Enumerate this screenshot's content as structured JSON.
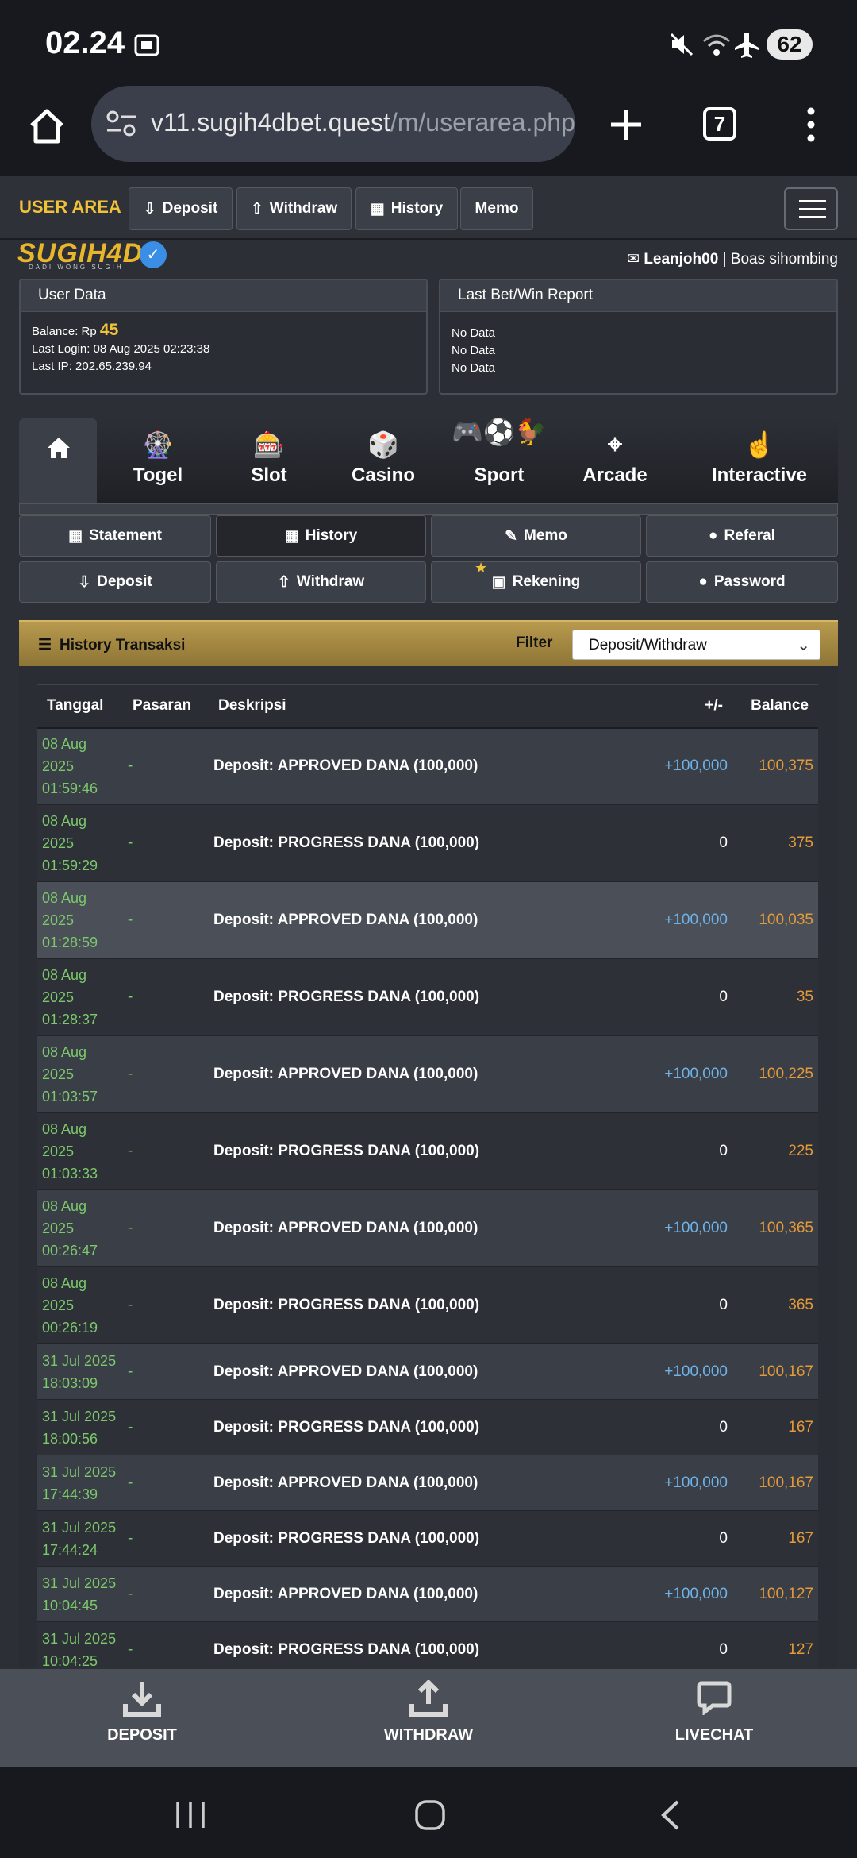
{
  "status_bar": {
    "time": "02.24",
    "battery": "62"
  },
  "browser": {
    "url_main": "v11.sugih4dbet.quest",
    "url_path": "/m/userarea.php",
    "tab_count": "7"
  },
  "user_nav": {
    "title": "USER AREA",
    "buttons": [
      {
        "label": "Deposit",
        "icon": "deposit-icon"
      },
      {
        "label": "Withdraw",
        "icon": "withdraw-icon"
      },
      {
        "label": "History",
        "icon": "calendar-icon"
      },
      {
        "label": "Memo"
      }
    ]
  },
  "logo": {
    "text": "SUGIH4D",
    "tagline": "DADI WONG SUGIH"
  },
  "user": {
    "username": "Leanjoh00",
    "fullname": "Boas sihombing"
  },
  "user_data": {
    "header": "User Data",
    "balance_label": "Balance: Rp",
    "balance_value": "45",
    "last_login": "Last Login: 08 Aug 2025 02:23:38",
    "last_ip": "Last IP: 202.65.239.94"
  },
  "report": {
    "header": "Last Bet/Win Report",
    "lines": [
      "No Data",
      "No Data",
      "No Data"
    ]
  },
  "game_tabs": [
    "Togel",
    "Slot",
    "Casino",
    "Sport",
    "Arcade",
    "Interactive"
  ],
  "sub_menu": {
    "row1": [
      "Statement",
      "History",
      "Memo",
      "Referal"
    ],
    "row2": [
      "Deposit",
      "Withdraw",
      "Rekening",
      "Password"
    ]
  },
  "history": {
    "title": "History Transaksi",
    "filter_label": "Filter",
    "filter_value": "Deposit/Withdraw",
    "columns": [
      "Tanggal",
      "Pasaran",
      "Deskripsi",
      "+/-",
      "Balance"
    ],
    "rows": [
      {
        "date": [
          "08 Aug",
          "2025",
          "01:59:46"
        ],
        "pasaran": "-",
        "desc": "Deposit: APPROVED DANA (100,000)",
        "pm": "+100,000",
        "balance": "100,375"
      },
      {
        "date": [
          "08 Aug",
          "2025",
          "01:59:29"
        ],
        "pasaran": "-",
        "desc": "Deposit: PROGRESS DANA (100,000)",
        "pm": "0",
        "balance": "375"
      },
      {
        "date": [
          "08 Aug",
          "2025",
          "01:28:59"
        ],
        "pasaran": "-",
        "desc": "Deposit: APPROVED DANA (100,000)",
        "pm": "+100,000",
        "balance": "100,035"
      },
      {
        "date": [
          "08 Aug",
          "2025",
          "01:28:37"
        ],
        "pasaran": "-",
        "desc": "Deposit: PROGRESS DANA (100,000)",
        "pm": "0",
        "balance": "35"
      },
      {
        "date": [
          "08 Aug",
          "2025",
          "01:03:57"
        ],
        "pasaran": "-",
        "desc": "Deposit: APPROVED DANA (100,000)",
        "pm": "+100,000",
        "balance": "100,225"
      },
      {
        "date": [
          "08 Aug",
          "2025",
          "01:03:33"
        ],
        "pasaran": "-",
        "desc": "Deposit: PROGRESS DANA (100,000)",
        "pm": "0",
        "balance": "225"
      },
      {
        "date": [
          "08 Aug",
          "2025",
          "00:26:47"
        ],
        "pasaran": "-",
        "desc": "Deposit: APPROVED DANA (100,000)",
        "pm": "+100,000",
        "balance": "100,365"
      },
      {
        "date": [
          "08 Aug",
          "2025",
          "00:26:19"
        ],
        "pasaran": "-",
        "desc": "Deposit: PROGRESS DANA (100,000)",
        "pm": "0",
        "balance": "365"
      },
      {
        "date": [
          "31 Jul 2025",
          "18:03:09"
        ],
        "pasaran": "-",
        "desc": "Deposit: APPROVED DANA (100,000)",
        "pm": "+100,000",
        "balance": "100,167"
      },
      {
        "date": [
          "31 Jul 2025",
          "18:00:56"
        ],
        "pasaran": "-",
        "desc": "Deposit: PROGRESS DANA (100,000)",
        "pm": "0",
        "balance": "167"
      },
      {
        "date": [
          "31 Jul 2025",
          "17:44:39"
        ],
        "pasaran": "-",
        "desc": "Deposit: APPROVED DANA (100,000)",
        "pm": "+100,000",
        "balance": "100,167"
      },
      {
        "date": [
          "31 Jul 2025",
          "17:44:24"
        ],
        "pasaran": "-",
        "desc": "Deposit: PROGRESS DANA (100,000)",
        "pm": "0",
        "balance": "167"
      },
      {
        "date": [
          "31 Jul 2025",
          "10:04:45"
        ],
        "pasaran": "-",
        "desc": "Deposit: APPROVED DANA (100,000)",
        "pm": "+100,000",
        "balance": "100,127"
      },
      {
        "date": [
          "31 Jul 2025",
          "10:04:25"
        ],
        "pasaran": "-",
        "desc": "Deposit: PROGRESS DANA (100,000)",
        "pm": "0",
        "balance": "127"
      }
    ]
  },
  "action_bar": [
    {
      "label": "DEPOSIT",
      "icon": "download-icon"
    },
    {
      "label": "WITHDRAW",
      "icon": "upload-icon"
    },
    {
      "label": "LIVECHAT",
      "icon": "chat-icon"
    }
  ],
  "colors": {
    "accent_gold": "#f0c23a",
    "date_green": "#7cc96c",
    "positive_blue": "#6fb3e8",
    "balance_orange": "#e39a3a"
  }
}
